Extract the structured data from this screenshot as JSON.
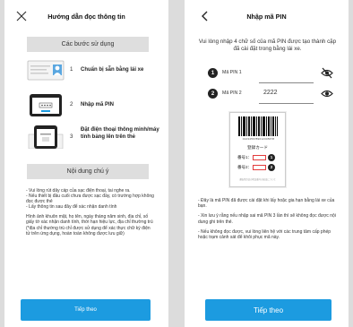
{
  "left_screen": {
    "title": "Hướng dẫn đọc thông tin",
    "close_icon": "close-icon",
    "steps_header": "Các bước sử dụng",
    "steps": [
      {
        "num": "1",
        "label": "Chuẩn bị sẵn bằng lái xe",
        "icon": "license-card-icon"
      },
      {
        "num": "2",
        "label": "Nhập mã PIN",
        "icon": "phone-pin-icon"
      },
      {
        "num": "3",
        "label": "Đặt điện thoại thông minh/máy tính bảng lên trên thẻ",
        "icon": "phone-on-card-icon"
      }
    ],
    "notes_header": "Nội dung chú ý",
    "notes": [
      "- Vui lòng rút dây cáp của sạc điện thoại, tai nghe ra.",
      "- Nếu thiết bị đầu cuối chưa được sạc đầy, có trường hợp không đọc được thẻ",
      "- Lấy thông tin sau đây để xác nhận danh tính",
      "",
      "Hình ảnh khuôn mặt, họ tên, ngày tháng năm sinh, địa chỉ, số giấy tờ xác nhận danh tính, thời hạn hiệu lực, địa chỉ thường trú (*địa chỉ thường trú chỉ được sử dụng để xác thực chữ ký điện tử trên ứng dụng, hoàn toàn không được lưu giữ)"
    ],
    "next_button": "Tiếp theo"
  },
  "right_screen": {
    "title": "Nhập mã PIN",
    "back_icon": "back-chevron-icon",
    "instruction": "Vui lòng nhập 4 chữ số của mã PIN được tạo thành cặp đã cài đặt trong bằng lái xe.",
    "pin_fields": [
      {
        "badge": "1",
        "label": "Mã PIN 1",
        "value": "",
        "eye_icon": "eye-hidden-icon"
      },
      {
        "badge": "2",
        "label": "Mã PIN 2",
        "value": "2222",
        "eye_icon": "eye-visible-icon"
      }
    ],
    "card": {
      "barcode_number": "0123456789012345678",
      "card_title": "登録カード",
      "row1_label": "番号1：",
      "row1_badge": "1",
      "row2_label": "番号2：",
      "row2_badge": "2",
      "fine_print": "運転免許証の暗証番号の届出について"
    },
    "notes": [
      "- Đây là mã PIN đã được cài đặt khi lấy hoặc gia hạn bằng lái xe của bạn.",
      "",
      "- Xin lưu ý rằng nếu nhập sai mã PIN 3 lần thì sẽ không đọc được nội dung ghi trên thẻ.",
      "",
      "- Nếu không đọc được, vui lòng liên hệ với các trung tâm cấp phép hoặc trạm cảnh sát để khôi phục mã này."
    ],
    "next_button": "Tiếp theo"
  },
  "colors": {
    "accent": "#1c9be0",
    "section_bg": "#dedede",
    "outer_bg": "#dcdcdc",
    "card_highlight": "#e23b3b"
  }
}
